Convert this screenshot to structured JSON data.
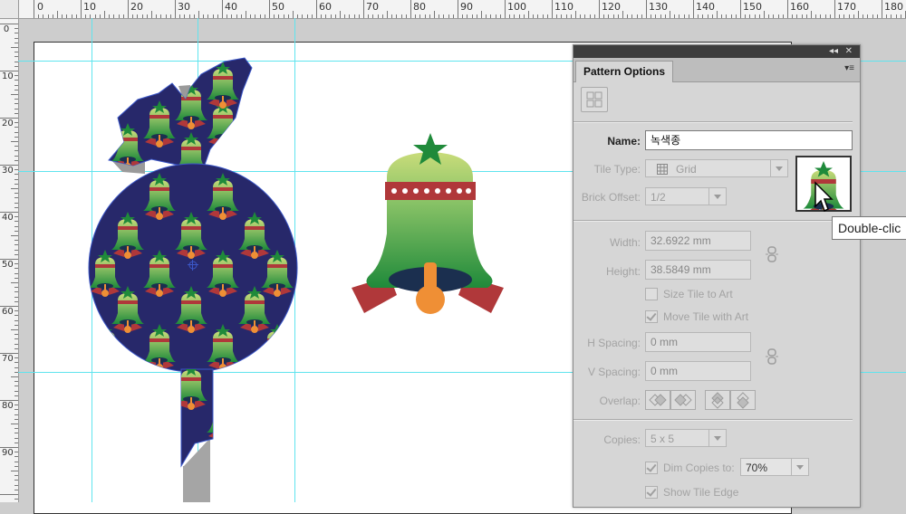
{
  "ruler": {
    "top": [
      "0",
      "10",
      "20",
      "30",
      "40",
      "50",
      "60",
      "70",
      "80",
      "90",
      "100",
      "110",
      "120",
      "130",
      "140",
      "150",
      "160",
      "170",
      "180"
    ],
    "left": [
      "0",
      "10",
      "20",
      "30",
      "40",
      "50",
      "60",
      "70",
      "80",
      "90"
    ]
  },
  "icons": {
    "tile_tool": "tile-edit-icon",
    "grid": "grid-icon",
    "link": "chain-link-icon",
    "cursor": "arrow-cursor-icon"
  },
  "colors": {
    "navy": "#27286a",
    "green_dark": "#1f8a3a",
    "green_light": "#b8d66a",
    "red": "#b0383a",
    "orange": "#ef8f35",
    "guide": "#5fe4ee"
  },
  "panel": {
    "title": "Pattern Options",
    "collapse_glyph": "◂◂",
    "close_glyph": "✕",
    "menu_glyph": "▾≡",
    "name_label": "Name:",
    "name_value": "녹색종",
    "tile_type_label": "Tile Type:",
    "tile_type_value": "Grid",
    "brick_offset_label": "Brick Offset:",
    "brick_offset_value": "1/2",
    "width_label": "Width:",
    "width_value": "32.6922 mm",
    "height_label": "Height:",
    "height_value": "38.5849 mm",
    "size_tile_label": "Size Tile to Art",
    "move_tile_label": "Move Tile with Art",
    "h_spacing_label": "H Spacing:",
    "h_spacing_value": "0 mm",
    "v_spacing_label": "V Spacing:",
    "v_spacing_value": "0 mm",
    "overlap_label": "Overlap:",
    "copies_label": "Copies:",
    "copies_value": "5 x 5",
    "dim_copies_label": "Dim Copies to:",
    "dim_copies_value": "70%",
    "show_tile_edge_label": "Show Tile Edge"
  },
  "tooltip": "Double-clic"
}
